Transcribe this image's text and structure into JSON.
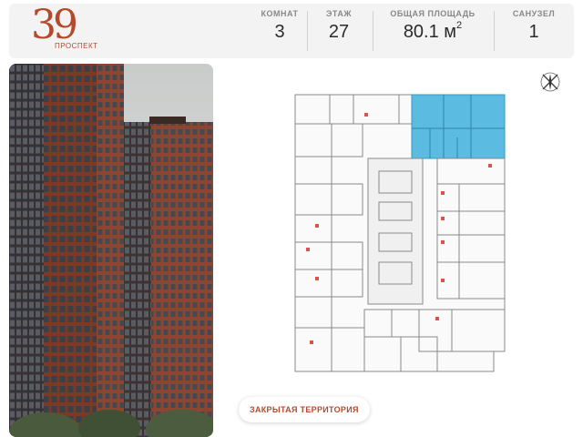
{
  "logo": {
    "number": "39",
    "subtitle": "ПРОСПЕКТ"
  },
  "stats": [
    {
      "label": "КОМНАТ",
      "value": "3"
    },
    {
      "label": "ЭТАЖ",
      "value": "27"
    },
    {
      "label": "ОБЩАЯ ПЛОЩАДЬ",
      "value": "80.1 м",
      "superscript": "2"
    },
    {
      "label": "САНУЗЕЛ",
      "value": "1"
    }
  ],
  "badge": {
    "label": "ЗАКРЫТАЯ ТЕРРИТОРИЯ"
  },
  "plan": {
    "highlight_color": "#5bbbe0",
    "wall_color": "#8a8a8a",
    "accent_color": "#d9534f"
  },
  "brand": {
    "accent": "#b44a2c"
  }
}
